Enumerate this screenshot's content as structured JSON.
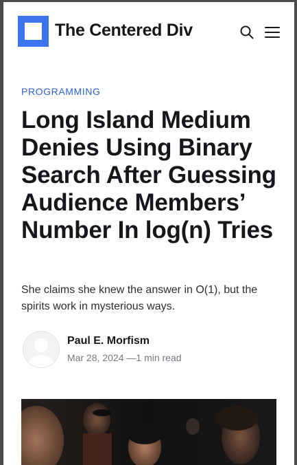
{
  "site": {
    "title": "The Centered Div",
    "logo_icon": "square-logo-icon",
    "brand_color": "#3b73f0"
  },
  "header": {
    "search_icon": "search-icon",
    "menu_icon": "hamburger-menu-icon"
  },
  "article": {
    "category": "PROGRAMMING",
    "title": "Long Island Medium Denies Using Binary Search After Guessing Audience Members’ Number In log(n) Tries",
    "excerpt": "She claims she knew the answer in O(1), but the spirits work in mysterious ways.",
    "author": {
      "name": "Paul E. Morfism",
      "avatar_icon": "default-avatar-icon"
    },
    "date": "Mar 28, 2024",
    "separator": "—",
    "read_time": "1 min read",
    "category_color": "#2f63d0"
  }
}
